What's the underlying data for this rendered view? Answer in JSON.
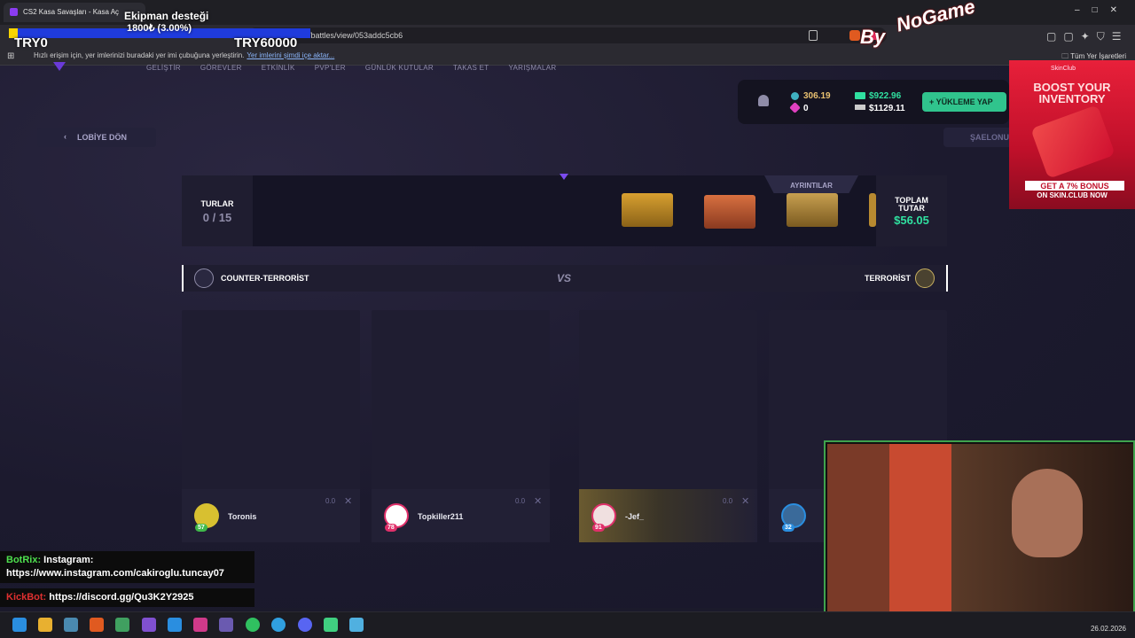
{
  "browser": {
    "tab_title": "CS2 Kasa Savaşları - Kasa Aç",
    "url": "skin.club/tr/battles/view/053addc5cb6",
    "bookmark_message": "Hızlı erişim için, yer imlerinizi buradaki yer imi çubuğuna yerleştirin.",
    "bookmark_link": "Yer imlerini şimdi içe aktar...",
    "bookmarks_folder": "Tüm Yer İşaretleri"
  },
  "overlay": {
    "donation_title": "Ekipman desteği",
    "donation_amount": "1800₺ (3.00%)",
    "donation_min": "TRY0",
    "donation_max": "TRY60000",
    "donation_progress": 0.03,
    "brand_by": "By",
    "brand_name": "NoGame"
  },
  "site": {
    "nav": [
      "GELİŞTİR",
      "GÖREVLER",
      "ETKİNLİK",
      "PVP'LER",
      "GÜNLÜK KUTULAR",
      "TAKAS ET",
      "YARIŞMALAR"
    ],
    "wallet": {
      "gems": "306.19",
      "tickets": "0",
      "balance": "$922.96",
      "total": "$1129.11",
      "deposit_label": "YÜKLEME YAP"
    },
    "back_label": "LOBİYE DÖN",
    "save_label": "ŞAELONU",
    "rounds_label": "TURLAR",
    "rounds_value": "0 / 15",
    "details_label": "AYRINTILAR",
    "total_label": "TOPLAM TUTAR",
    "total_value": "$56.05",
    "team_left": "COUNTER-TERRORİST",
    "vs": "VS",
    "team_right": "TERRORİST",
    "players": [
      {
        "name": "Toronis",
        "level": "57",
        "score": "0.0",
        "color": "#3fb94a",
        "avatar": "#d8c030"
      },
      {
        "name": "Topkiller211",
        "level": "78",
        "score": "0.0",
        "color": "#e0306a",
        "avatar": "#ffffff"
      },
      {
        "name": "-Jef_",
        "level": "91",
        "score": "0.0",
        "color": "#e0306a",
        "avatar": "#f0e0e0"
      },
      {
        "name": "",
        "level": "32",
        "score": "",
        "color": "#2a8ee0",
        "avatar": "#3a6a9a"
      }
    ]
  },
  "ad": {
    "brand": "SkinClub",
    "title": "BOOST YOUR INVENTORY",
    "bonus": "GET A 7% BONUS",
    "sub": "ON SKIN.CLUB NOW"
  },
  "chat": [
    {
      "bot": "BotRix:",
      "text": "Instagram: https://www.instagram.com/cakiroglu.tuncay07",
      "color": "#4ee04e"
    },
    {
      "bot": "KickBot:",
      "text": "https://discord.gg/Qu3K2Y2925",
      "color": "#e03030"
    }
  ],
  "taskbar": {
    "date": "26.02.2026"
  }
}
